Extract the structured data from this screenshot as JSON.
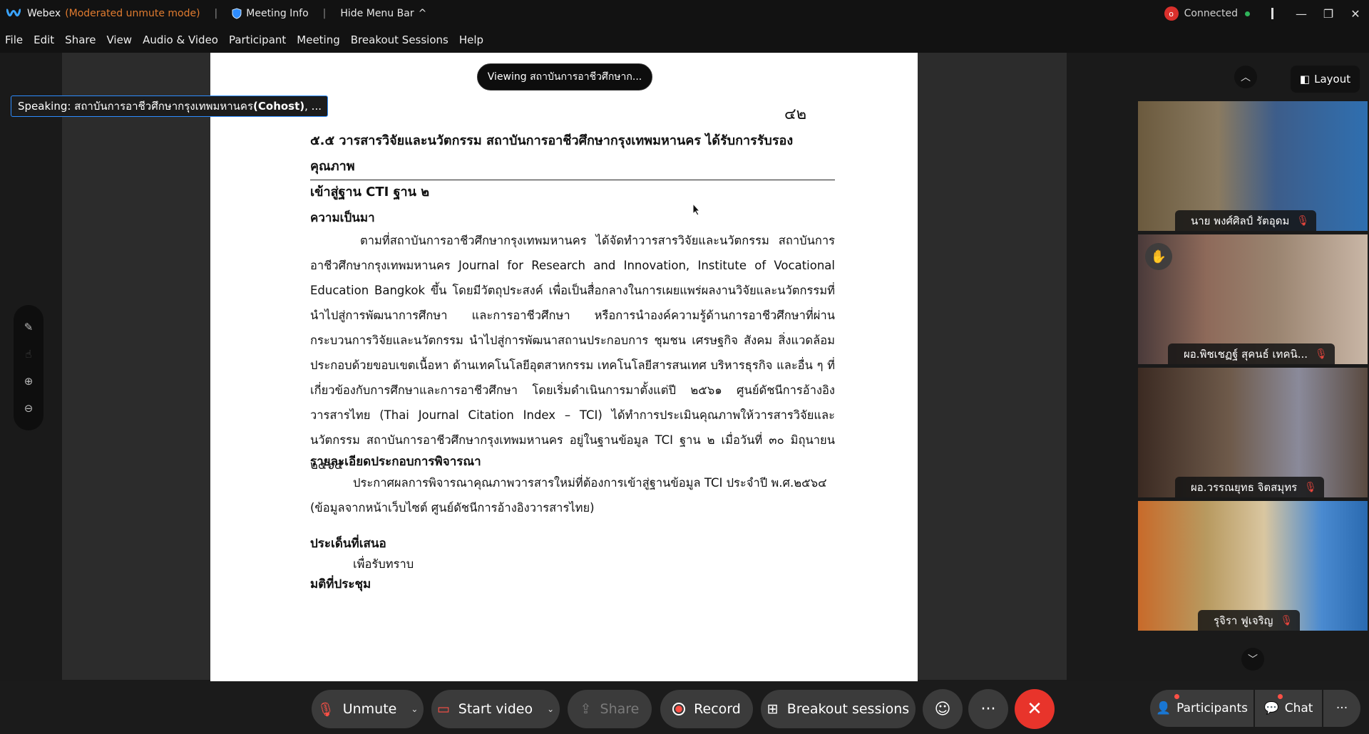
{
  "titlebar": {
    "app_name": "Webex",
    "mode": "(Moderated unmute mode)",
    "meeting_info": "Meeting Info",
    "hide_menu": "Hide Menu Bar",
    "connection": "Connected"
  },
  "menu": [
    "File",
    "Edit",
    "Share",
    "View",
    "Audio & Video",
    "Participant",
    "Meeting",
    "Breakout Sessions",
    "Help"
  ],
  "share": {
    "viewing_label": "Viewing สถาบันการอาชีวศึกษาก...",
    "speaking_prefix": "Speaking: สถาบันการอาชีวศึกษากรุงเทพมหานคร ",
    "speaking_role": "(Cohost)",
    "speaking_suffix": ", ..."
  },
  "document": {
    "page_number": "๔๒",
    "heading_line1": "๕.๕  วารสารวิจัยและนวัตกรรม สถาบันการอาชีวศึกษากรุงเทพมหานคร ได้รับการรับรองคุณภาพ",
    "heading_line2": "เข้าสู่ฐาน CTI ฐาน ๒",
    "section1_title": "ความเป็นมา",
    "section1_body": "ตามที่สถาบันการอาชีวศึกษากรุงเทพมหานคร ได้จัดทำวารสารวิจัยและนวัตกรรม สถาบันการอาชีวศึกษากรุงเทพมหานคร Journal for Research and Innovation, Institute of Vocational Education Bangkok ขึ้น โดยมีวัตถุประสงค์ เพื่อเป็นสื่อกลางในการเผยแพร่ผลงานวิจัยและนวัตกรรมที่นำไปสู่การพัฒนาการศึกษา และการอาชีวศึกษา หรือการนำองค์ความรู้ด้านการอาชีวศึกษาที่ผ่านกระบวนการวิจัยและนวัตกรรม นำไปสู่การพัฒนาสถานประกอบการ ชุมชน เศรษฐกิจ สังคม สิ่งแวดล้อม ประกอบด้วยขอบเขตเนื้อหา ด้านเทคโนโลยีอุตสาหกรรม เทคโนโลยีสารสนเทศ บริหารธุรกิจ และอื่น ๆ ที่เกี่ยวข้องกับการศึกษาและการอาชีวศึกษา โดยเริ่มดำเนินการมาตั้งแต่ปี ๒๕๖๑ ศูนย์ดัชนีการอ้างอิงวารสารไทย (Thai Journal Citation Index – TCI) ได้ทำการประเมินคุณภาพให้วารสารวิจัยและนวัตกรรม สถาบันการอาชีวศึกษากรุงเทพมหานคร อยู่ในฐานข้อมูล TCI  ฐาน ๒ เมื่อวันที่ ๓๐ มิถุนายน ๒๕๖๔",
    "section2_title": "รายละเอียดประกอบการพิจารณา",
    "section2_body": "ประกาศผลการพิจารณาคุณภาพวารสารใหม่ที่ต้องการเข้าสู่ฐานข้อมูล TCI ประจำปี พ.ศ.๒๕๖๔",
    "section2_note": "(ข้อมูลจากหน้าเว็บไซต์ ศูนย์ดัชนีการอ้างอิงวารสารไทย)",
    "section3_title": "ประเด็นที่เสนอ",
    "section3_item": "เพื่อรับทราบ",
    "section4_title": "มติที่ประชุม"
  },
  "panel": {
    "layout_label": "Layout",
    "participants": [
      {
        "name": "นาย พงศ์ศิลป์ รัตอุดม",
        "muted": true
      },
      {
        "name": "ผอ.พิชเชฏฐ์ สุคนธ์ เทคนิ...",
        "muted": true,
        "hand_raised": true
      },
      {
        "name": "ผอ.วรรณยุทธ จิตสมุทร",
        "muted": true
      },
      {
        "name": "รุจิรา ฟูเจริญ",
        "muted": true
      }
    ]
  },
  "controls": {
    "unmute": "Unmute",
    "start_video": "Start video",
    "share": "Share",
    "record": "Record",
    "breakout": "Breakout sessions",
    "participants": "Participants",
    "chat": "Chat"
  },
  "colors": {
    "accent_blue": "#2d8cff",
    "end_red": "#e8342b",
    "mute_red": "#ff5046",
    "mode_orange": "#e07b2f"
  }
}
